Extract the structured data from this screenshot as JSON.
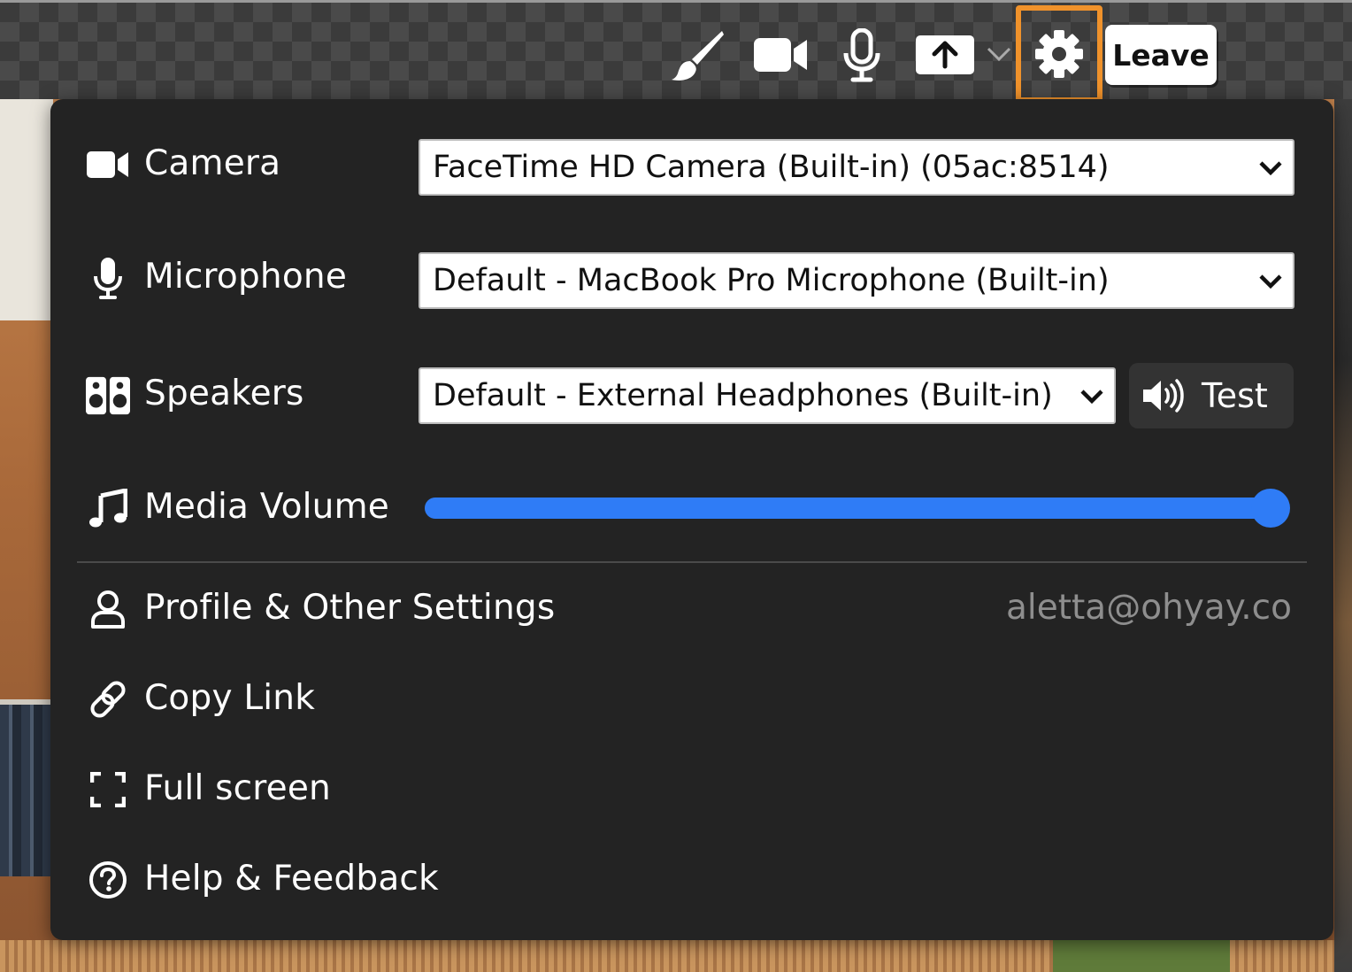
{
  "toolbar": {
    "icons": [
      "paintbrush-icon",
      "video-camera-icon",
      "microphone-icon",
      "share-upload-icon",
      "chevron-down-icon",
      "gear-icon"
    ],
    "leave_label": "Leave",
    "highlight_color": "#f0922b"
  },
  "settings": {
    "camera": {
      "label": "Camera",
      "icon": "video-camera-icon",
      "selected": "FaceTime HD Camera (Built-in) (05ac:8514)"
    },
    "microphone": {
      "label": "Microphone",
      "icon": "microphone-icon",
      "selected": "Default - MacBook Pro Microphone (Built-in)"
    },
    "speakers": {
      "label": "Speakers",
      "icon": "speakers-icon",
      "selected": "Default - External Headphones (Built-in)",
      "test_label": "Test"
    },
    "media_volume": {
      "label": "Media Volume",
      "icon": "music-note-icon",
      "value_fraction": 0.98,
      "accent_color": "#2f7cf6"
    }
  },
  "menu": {
    "profile": {
      "label": "Profile & Other Settings",
      "email": "aletta@ohyay.co",
      "icon": "user-icon"
    },
    "copy_link": {
      "label": "Copy Link",
      "icon": "link-icon"
    },
    "full_screen": {
      "label": "Full screen",
      "icon": "fullscreen-icon"
    },
    "help": {
      "label": "Help & Feedback",
      "icon": "help-circle-icon"
    }
  }
}
